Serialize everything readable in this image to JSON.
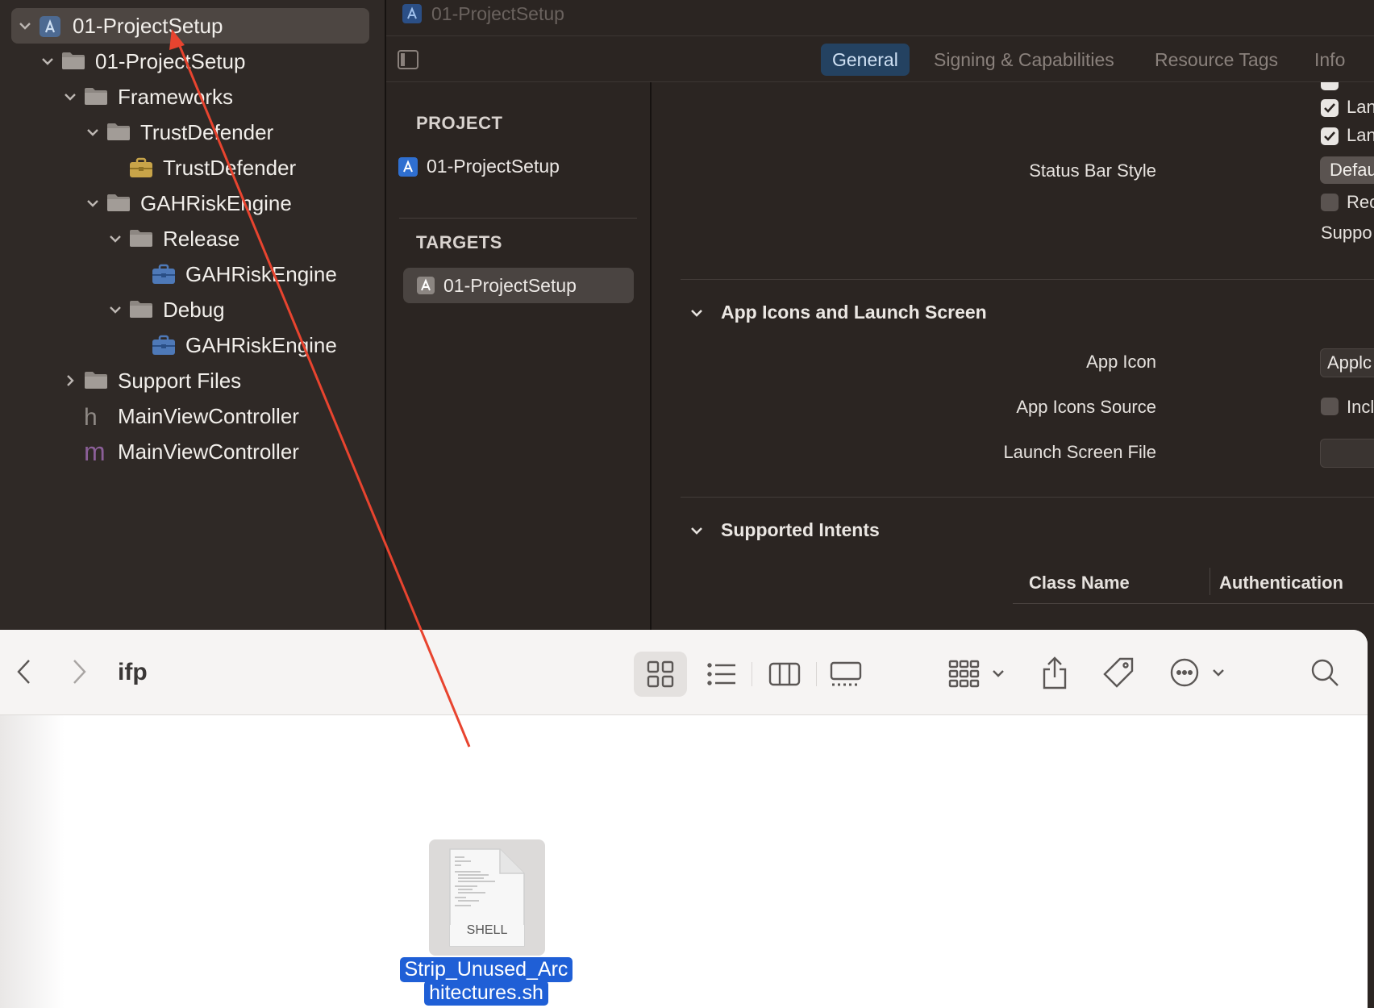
{
  "navigator": {
    "items": [
      {
        "label": "01-ProjectSetup",
        "icon": "xcode-project-icon",
        "level": 0,
        "expanded": true,
        "selected": true
      },
      {
        "label": "01-ProjectSetup",
        "icon": "folder-icon",
        "level": 1,
        "expanded": true
      },
      {
        "label": "Frameworks",
        "icon": "folder-icon",
        "level": 2,
        "expanded": true
      },
      {
        "label": "TrustDefender",
        "icon": "folder-icon",
        "level": 3,
        "expanded": true
      },
      {
        "label": "TrustDefender",
        "icon": "framework-toolbox-icon",
        "level": 4
      },
      {
        "label": "GAHRiskEngine",
        "icon": "folder-icon",
        "level": 3,
        "expanded": true
      },
      {
        "label": "Release",
        "icon": "folder-icon",
        "level": 4,
        "expanded": true
      },
      {
        "label": "GAHRiskEngine",
        "icon": "framework-toolbox-icon",
        "level": 5
      },
      {
        "label": "Debug",
        "icon": "folder-icon",
        "level": 4,
        "expanded": true
      },
      {
        "label": "GAHRiskEngine",
        "icon": "framework-toolbox-icon",
        "level": 5
      },
      {
        "label": "Support Files",
        "icon": "folder-icon",
        "level": 2,
        "expanded": false
      },
      {
        "label": "MainViewController",
        "icon": "header-h-icon",
        "level": 2
      },
      {
        "label": "MainViewController",
        "icon": "implementation-m-icon",
        "level": 2
      }
    ]
  },
  "editor": {
    "jump_title": "01-ProjectSetup",
    "tabs": [
      "General",
      "Signing & Capabilities",
      "Resource Tags",
      "Info"
    ],
    "active_tab": "General",
    "project_header": "PROJECT",
    "project_item": "01-ProjectSetup",
    "targets_header": "TARGETS",
    "target_item": "01-ProjectSetup"
  },
  "settings": {
    "cut_option_1": "Lan",
    "cut_option_2": "Lan",
    "status_bar_style_label": "Status Bar Style",
    "status_bar_style_value": "Defau",
    "requires_option": "Rec",
    "supported_label": "Suppo",
    "app_icons_section": "App Icons and Launch Screen",
    "app_icon_label": "App Icon",
    "app_icon_value": "Applc",
    "app_icons_source_label": "App Icons Source",
    "app_icons_source_value": "Incl",
    "launch_screen_label": "Launch Screen File",
    "intents_section": "Supported Intents",
    "col_class_name": "Class Name",
    "col_authentication": "Authentication"
  },
  "finder": {
    "folder_name": "ifp",
    "file_thumb_text": "SHELL",
    "file_name_line1": "Strip_Unused_Arc",
    "file_name_line2": "hitectures.sh"
  },
  "colors": {
    "annotation_arrow": "#e8442f",
    "selection_blue": "#1f5fd6",
    "active_tab_bg": "#244261"
  }
}
